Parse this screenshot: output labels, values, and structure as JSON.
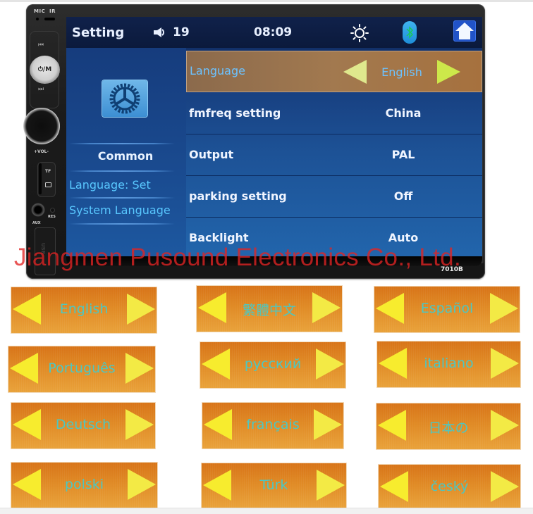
{
  "device": {
    "mic_label": "MIC",
    "ir_label": "IR",
    "prev_label": "⏮",
    "power_label": "⏻/M",
    "next_label": "⏭",
    "vol_label": "+VOL-",
    "tf_label": "TF",
    "res_label": "RES",
    "aux_label": "AUX",
    "usb_label": "USB",
    "model": "7010B"
  },
  "statusbar": {
    "title": "Setting",
    "volume_icon": "speaker-icon",
    "volume": "19",
    "time": "08:09",
    "brightness_icon": "sun-icon",
    "bluetooth_icon": "bluetooth-icon",
    "home_icon": "home-icon"
  },
  "left_pane": {
    "icon": "gear-icon",
    "category": "Common",
    "breadcrumb_1": "Language: Set",
    "breadcrumb_2": "System Language"
  },
  "settings": [
    {
      "label": "Language",
      "value": "English",
      "selected": true
    },
    {
      "label": "fmfreq setting",
      "value": "China"
    },
    {
      "label": "Output",
      "value": "PAL"
    },
    {
      "label": "parking setting",
      "value": "Off"
    },
    {
      "label": "Backlight",
      "value": "Auto"
    }
  ],
  "watermark": "Jiangmen Pusound Electronics Co., Ltd.",
  "language_options": [
    "English",
    "繁體中文",
    "Español",
    "Português",
    "русский",
    "italiano",
    "Deutsch",
    "français",
    "日本の",
    "polski",
    "Türk",
    "český"
  ],
  "colors": {
    "screen_blue": "#1d5296",
    "selected_row": "#a2794f",
    "accent_text": "#59c8ff",
    "card_orange": "#e08a25",
    "arrow_yellow": "#f7ec2e",
    "card_text": "#4cc7c2",
    "watermark_red": "#e22424"
  }
}
